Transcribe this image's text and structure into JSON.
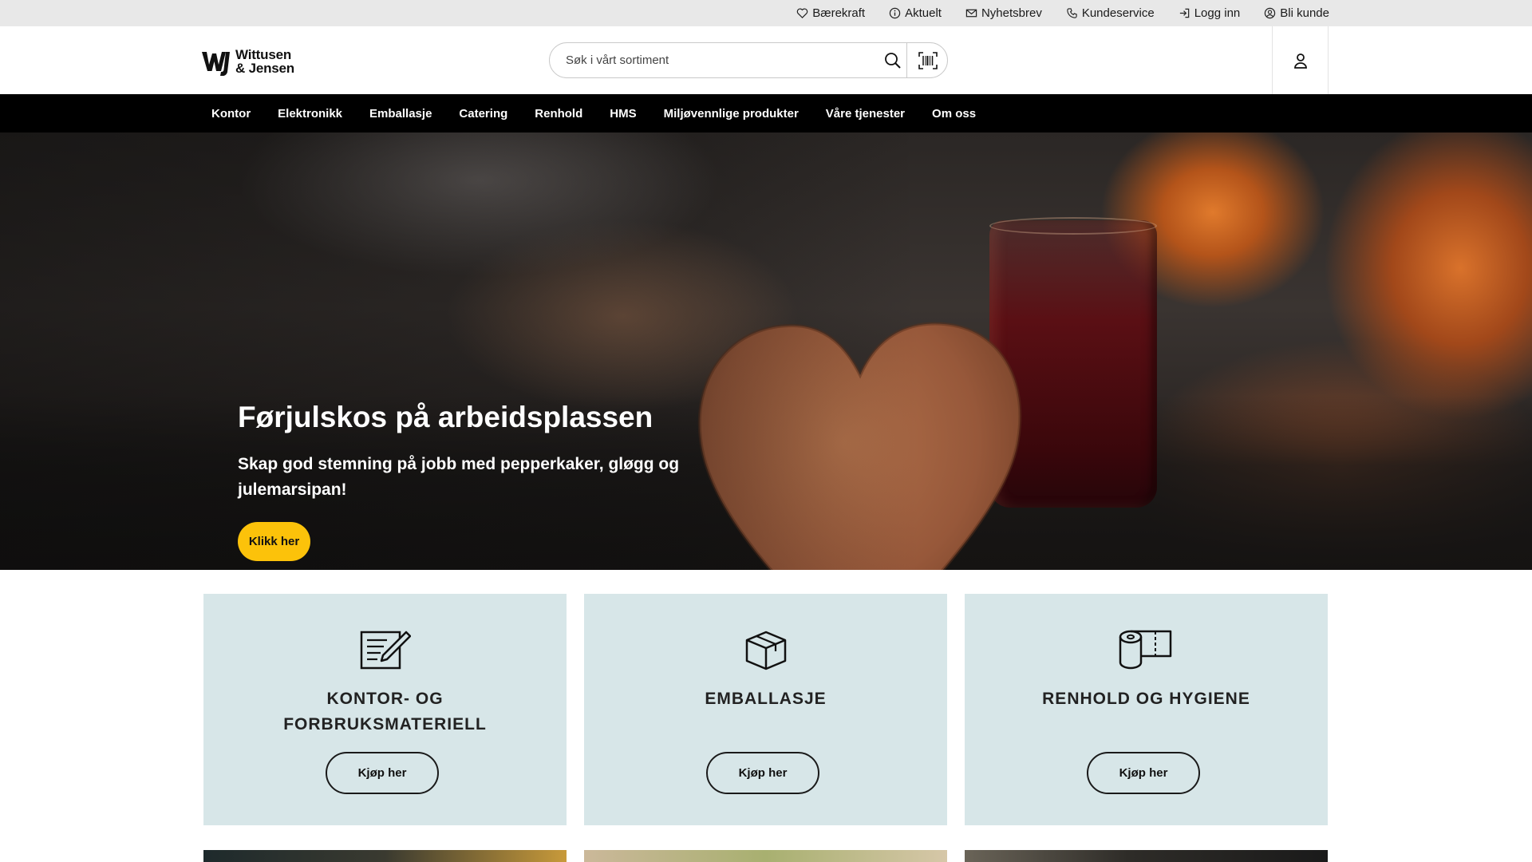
{
  "utility_bar": {
    "links": [
      {
        "label": "Bærekraft",
        "icon": "heart-icon"
      },
      {
        "label": "Aktuelt",
        "icon": "info-icon"
      },
      {
        "label": "Nyhetsbrev",
        "icon": "mail-icon"
      },
      {
        "label": "Kundeservice",
        "icon": "phone-icon"
      },
      {
        "label": "Logg inn",
        "icon": "login-icon"
      },
      {
        "label": "Bli kunde",
        "icon": "user-circle-icon"
      }
    ]
  },
  "header": {
    "logo_line1": "Wittusen",
    "logo_line2": "& Jensen",
    "search_placeholder": "Søk i vårt sortiment"
  },
  "main_nav": {
    "items": [
      "Kontor",
      "Elektronikk",
      "Emballasje",
      "Catering",
      "Renhold",
      "HMS",
      "Miljøvennlige produkter",
      "Våre tjenester",
      "Om oss"
    ]
  },
  "hero": {
    "title": "Førjulskos på arbeidsplassen",
    "subtitle": "Skap god stemning på jobb med pepperkaker, gløgg og julemarsipan!",
    "cta_label": "Klikk her",
    "cta_color": "#fcc20a"
  },
  "categories": [
    {
      "title": "KONTOR- OG FORBRUKSMATERIELL",
      "button": "Kjøp her",
      "icon": "notepad-pen-icon"
    },
    {
      "title": "EMBALLASJE",
      "button": "Kjøp her",
      "icon": "box-icon"
    },
    {
      "title": "RENHOLD OG HYGIENE",
      "button": "Kjøp her",
      "icon": "paper-roll-icon"
    }
  ],
  "colors": {
    "utility_bg": "#e8e8e8",
    "nav_bg": "#000000",
    "card_bg": "#d7e6e8",
    "accent": "#fcc20a"
  }
}
